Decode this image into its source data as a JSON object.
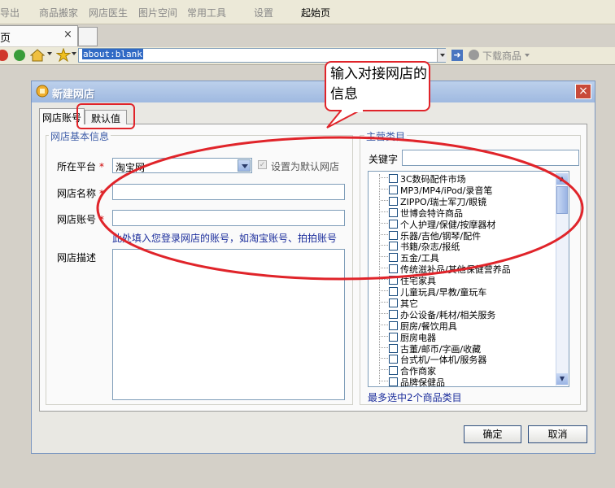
{
  "menu": {
    "items": [
      "导出",
      "商品搬家",
      "网店医生",
      "图片空间",
      "常用工具",
      "设置"
    ],
    "home": "起始页"
  },
  "browser": {
    "tab_label": "页",
    "tab_close": "×",
    "address": "about:blank",
    "download": "下载商品"
  },
  "dialog": {
    "title": "新建网店",
    "close": "×",
    "tabs": [
      "网店账号",
      "默认值"
    ],
    "basic_group": "网店基本信息",
    "platform_label": "所在平台",
    "platform_value": "淘宝网",
    "default_checkbox": "设置为默认网店",
    "shop_name_label": "网店名称",
    "shop_account_label": "网店账号",
    "account_hint": "此处填入您登录网店的账号，如淘宝账号、拍拍账号",
    "desc_label": "网店描述",
    "required_mark": "*",
    "category_group": "主营类目",
    "keyword_label": "关键字",
    "categories": [
      "3C数码配件市场",
      "MP3/MP4/iPod/录音笔",
      "ZIPPO/瑞士军刀/眼镜",
      "世博会特许商品",
      "个人护理/保健/按摩器材",
      "乐器/吉他/钢琴/配件",
      "书籍/杂志/报纸",
      "五金/工具",
      "传统滋补品/其他保健营养品",
      "住宅家具",
      "儿童玩具/早教/童玩车",
      "其它",
      "办公设备/耗材/相关服务",
      "厨房/餐饮用具",
      "厨房电器",
      "古董/邮币/字画/收藏",
      "台式机/一体机/服务器",
      "合作商家",
      "品牌保健品"
    ],
    "category_hint": "最多选中2个商品类目",
    "ok": "确定",
    "cancel": "取消"
  },
  "annotation": {
    "callout_text": "输入对接网店的信息"
  },
  "colors": {
    "annotation_red": "#e0242a",
    "hint_blue": "#1c2e9c",
    "group_title": "#3f5ea8"
  },
  "icons": [
    "back-icon",
    "refresh-icon",
    "home-icon",
    "star-icon",
    "go-arrow-icon",
    "download-icon",
    "shop-icon",
    "dropdown-icon",
    "scroll-up-icon",
    "scroll-down-icon"
  ]
}
